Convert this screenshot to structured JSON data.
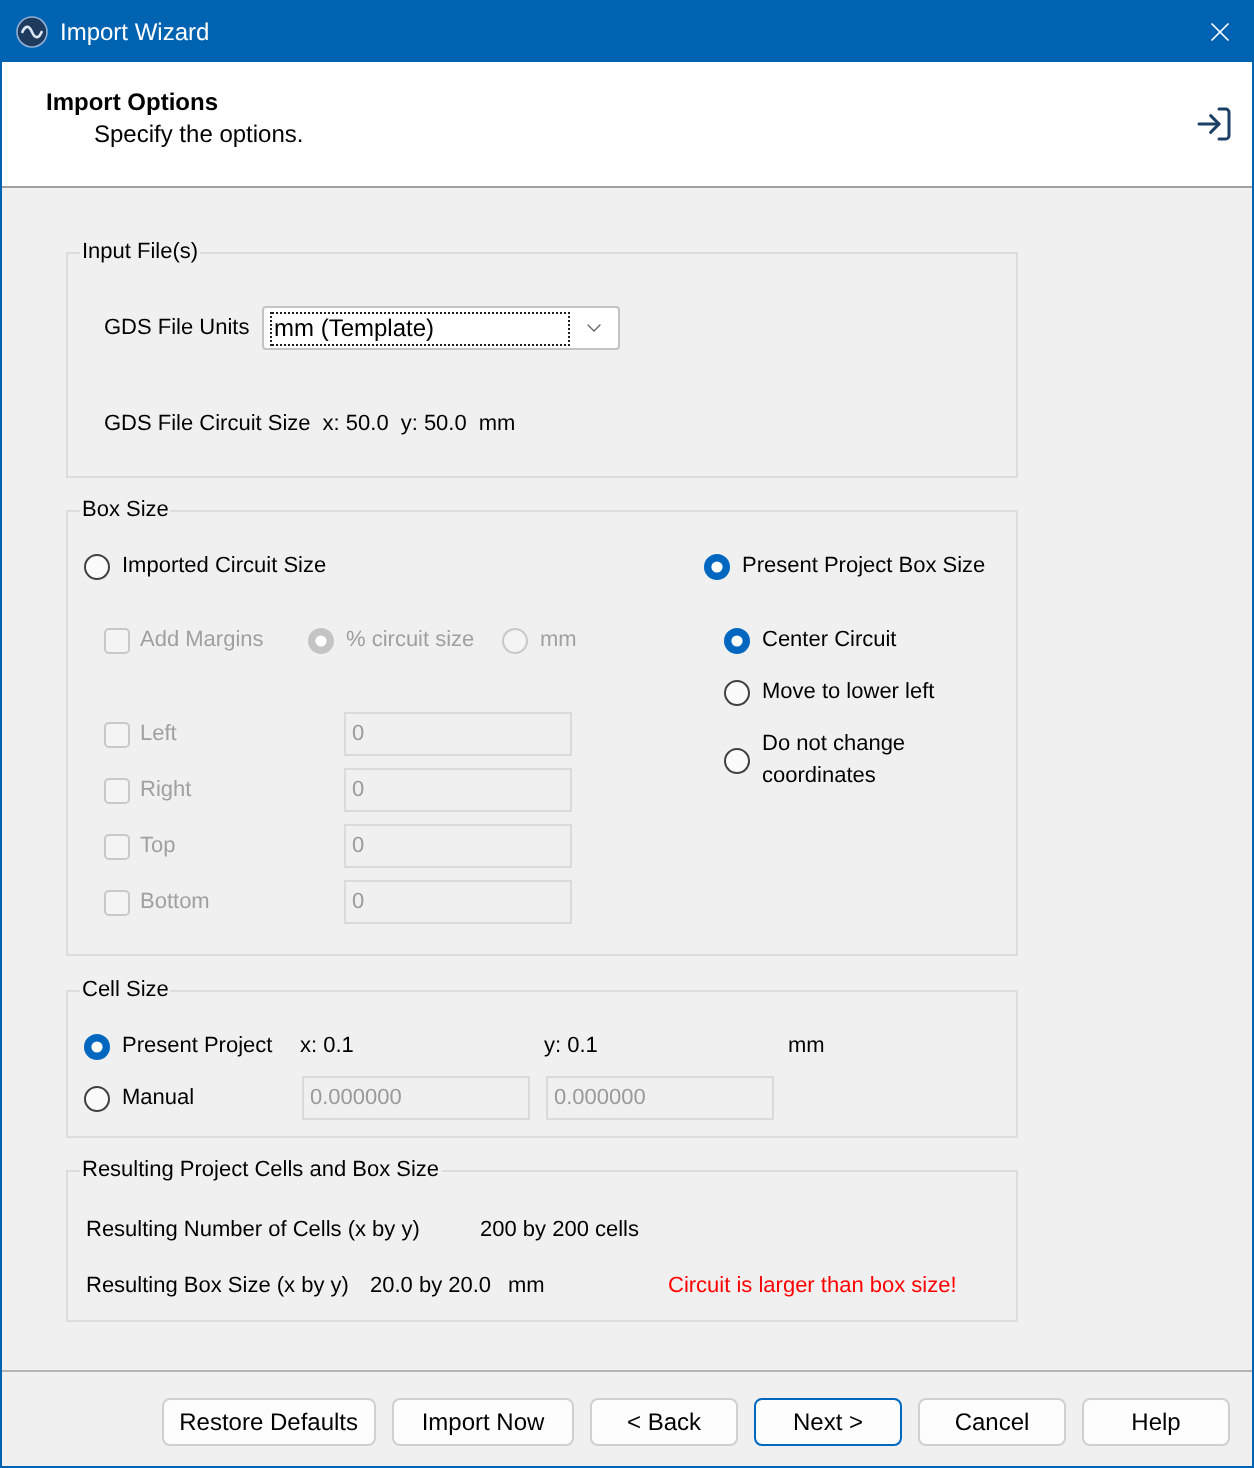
{
  "window": {
    "title": "Import Wizard"
  },
  "header": {
    "title": "Import Options",
    "subtitle": "Specify the options."
  },
  "input_files": {
    "legend": "Input File(s)",
    "units_label": "GDS File Units",
    "units_dropdown": {
      "value": "mm (Template)",
      "focused": true
    },
    "circuit_size": {
      "label": "GDS File Circuit Size",
      "x": "x: 50.0",
      "y": "y: 50.0",
      "unit": "mm"
    }
  },
  "box_size": {
    "legend": "Box Size",
    "modes": [
      {
        "label": "Imported Circuit Size",
        "selected": false
      },
      {
        "label": "Present Project Box Size",
        "selected": true
      }
    ],
    "add_margins": {
      "label": "Add Margins",
      "checked": false,
      "disabled": true
    },
    "margin_units": [
      {
        "label": "% circuit size",
        "selected": true,
        "disabled": true
      },
      {
        "label": "mm",
        "selected": false,
        "disabled": true
      }
    ],
    "margins": [
      {
        "label": "Left",
        "checked": false,
        "value": "0",
        "disabled": true
      },
      {
        "label": "Right",
        "checked": false,
        "value": "0",
        "disabled": true
      },
      {
        "label": "Top",
        "checked": false,
        "value": "0",
        "disabled": true
      },
      {
        "label": "Bottom",
        "checked": false,
        "value": "0",
        "disabled": true
      }
    ],
    "placement": [
      {
        "label": "Center Circuit",
        "selected": true
      },
      {
        "label": "Move to lower left",
        "selected": false
      },
      {
        "label": "Do not change coordinates",
        "selected": false
      }
    ]
  },
  "cell_size": {
    "legend": "Cell Size",
    "options": [
      {
        "kind": "readout",
        "label": "Present Project",
        "selected": true,
        "x": "x: 0.1",
        "y": "y: 0.1",
        "unit": "mm"
      },
      {
        "kind": "entry",
        "label": "Manual",
        "selected": false,
        "x_value": "0.000000",
        "y_value": "0.000000",
        "disabled": true
      }
    ]
  },
  "result": {
    "legend": "Resulting Project Cells and Box Size",
    "rows": [
      {
        "label": "Resulting Number of Cells (x by y)",
        "value": "200 by 200 cells"
      },
      {
        "label": "Resulting Box Size (x by y)",
        "value": "20.0 by 20.0",
        "unit": "mm",
        "warning": "Circuit is larger than box size!"
      }
    ]
  },
  "buttons": [
    {
      "label": "Restore Defaults",
      "default": false
    },
    {
      "label": "Import Now",
      "default": false
    },
    {
      "label": "< Back",
      "default": false
    },
    {
      "label": "Next >",
      "default": true
    },
    {
      "label": "Cancel",
      "default": false
    },
    {
      "label": "Help",
      "default": false
    }
  ]
}
